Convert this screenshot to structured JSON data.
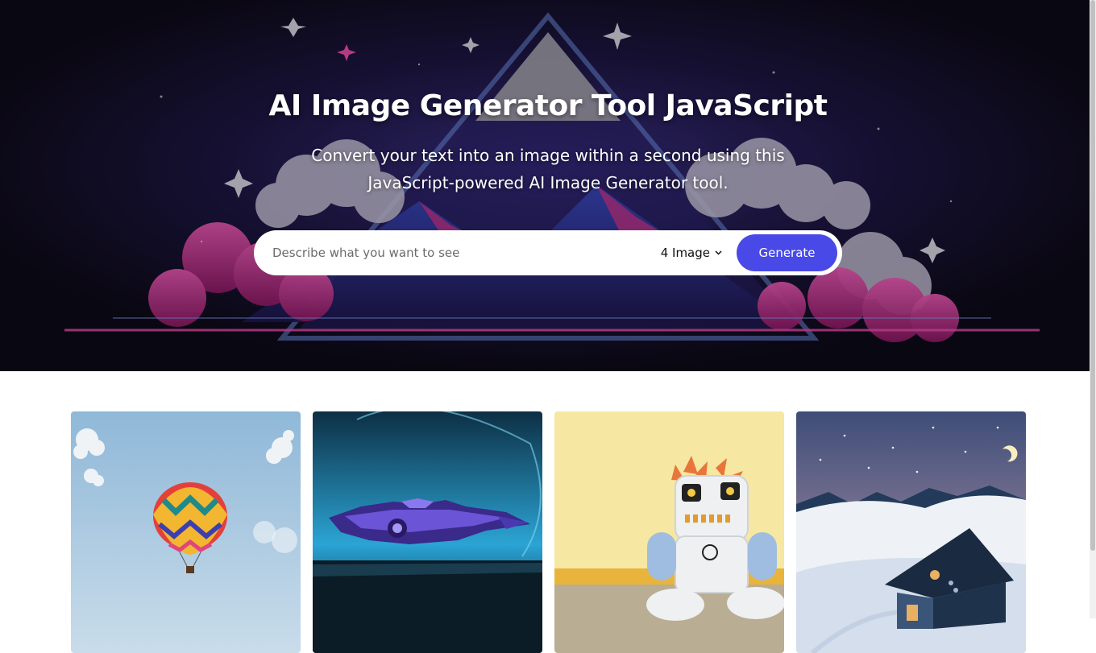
{
  "hero": {
    "title": "AI Image Generator Tool JavaScript",
    "subtitle": "Convert your text into an image within a second using this JavaScript-powered AI Image Generator tool."
  },
  "form": {
    "placeholder": "Describe what you want to see",
    "quantity_selected": "4 Image",
    "generate_label": "Generate"
  },
  "colors": {
    "accent": "#4949e7",
    "hero_magenta": "#e23aa0",
    "hero_blue": "#4a63d8"
  },
  "icons": {
    "dropdown": "chevron-down-icon"
  },
  "gallery": {
    "count": 4,
    "items": [
      "hot-air-balloon",
      "spaceship",
      "plush-robot",
      "snowy-cabin"
    ]
  }
}
